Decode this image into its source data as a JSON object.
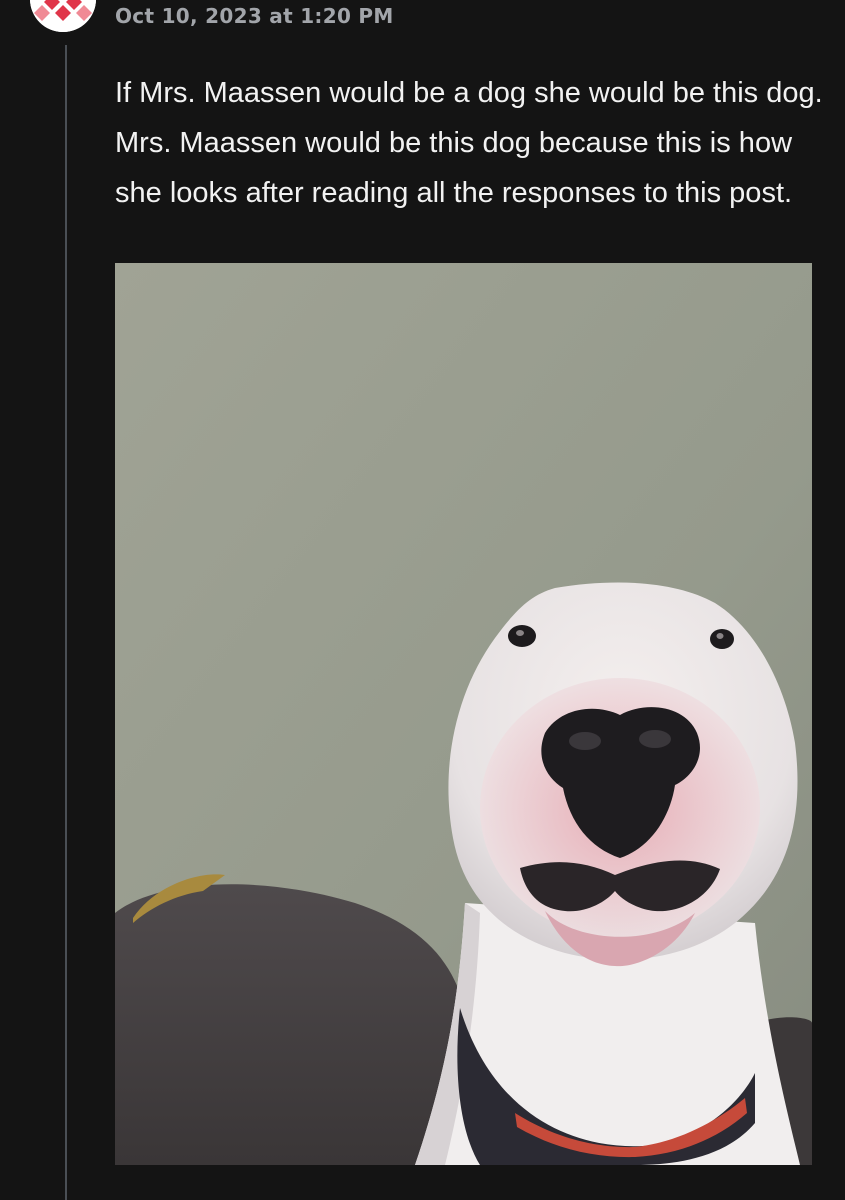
{
  "post": {
    "author_avatar_icon": "avatar-icon",
    "timestamp": "Oct 10, 2023 at 1:20 PM",
    "body": "If Mrs. Maassen would be a dog she would be this dog. Mrs. Maassen would be this dog because this is how she looks after reading all the responses to this post.",
    "image": {
      "subject": "photo-of-bull-terrier"
    }
  },
  "colors": {
    "background": "#141414",
    "thread_line": "#4a4f55",
    "timestamp": "#a2a5aa",
    "body_text": "#f2f2f2",
    "avatar_accent": "#e0364a"
  }
}
